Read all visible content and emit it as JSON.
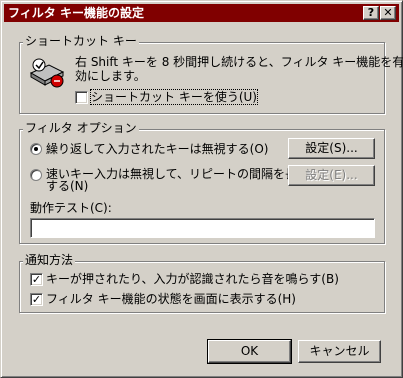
{
  "window": {
    "title": "フィルタ キー機能の設定",
    "help_glyph": "?",
    "close_glyph": "✕"
  },
  "shortcut": {
    "group_label": "ショートカット キー",
    "description_line1": "右 Shift キーを 8 秒間押し続けると、フィルタ キー機能を有",
    "description_line2": "効にします。",
    "use_shortcut_label": "ショートカット キーを使う(U)",
    "use_shortcut_checked": false,
    "icon": "keyboard-accessibility-icon"
  },
  "filter_options": {
    "group_label": "フィルタ オプション",
    "option1_label": "繰り返して入力されたキーは無視する(O)",
    "option1_selected": true,
    "option2_line1": "速いキー入力は無視して、リピートの間隔を長く",
    "option2_line2": "する(N)",
    "option2_selected": false,
    "settings1_label": "設定(S)...",
    "settings2_label": "設定(E)...",
    "test_label": "動作テスト(C):",
    "test_value": ""
  },
  "notification": {
    "group_label": "通知方法",
    "beep_label": "キーが押されたり、入力が認識されたら音を鳴らす(B)",
    "beep_checked": true,
    "status_label": "フィルタ キー機能の状態を画面に表示する(H)",
    "status_checked": true
  },
  "footer": {
    "ok_label": "OK",
    "cancel_label": "キャンセル"
  }
}
